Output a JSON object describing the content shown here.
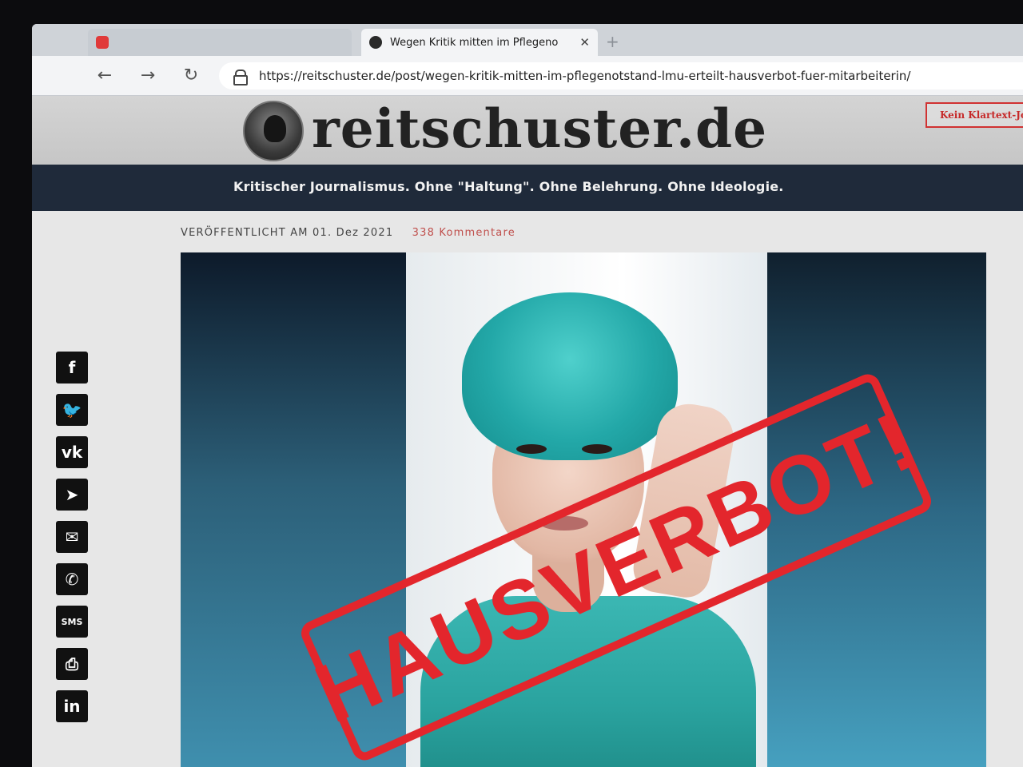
{
  "browser": {
    "tabs": [
      {
        "title": "Wegen Kritik mitten im Pflegeno",
        "active": true
      }
    ],
    "new_tab_label": "+",
    "close_label": "✕",
    "nav": {
      "back": "←",
      "forward": "→",
      "reload": "↻"
    },
    "url": "https://reitschuster.de/post/wegen-kritik-mitten-im-pflegenotstand-lmu-erteilt-hausverbot-fuer-mitarbeiterin/"
  },
  "site": {
    "logo_text": "reitschuster.de",
    "header_button": "Kein Klartext-Jo",
    "tagline": "Kritischer Journalismus. Ohne \"Haltung\". Ohne Belehrung. Ohne Ideologie."
  },
  "article": {
    "published": "VERÖFFENTLICHT AM 01. Dez 2021",
    "comments": "338 Kommentare",
    "stamp_text": "HAUSVERBOT!"
  },
  "share_buttons": [
    {
      "icon": "facebook-icon",
      "glyph": "f"
    },
    {
      "icon": "twitter-icon",
      "glyph": "🐦"
    },
    {
      "icon": "vk-icon",
      "glyph": "vk"
    },
    {
      "icon": "telegram-icon",
      "glyph": "➤"
    },
    {
      "icon": "email-icon",
      "glyph": "✉"
    },
    {
      "icon": "whatsapp-icon",
      "glyph": "✆"
    },
    {
      "icon": "sms-icon",
      "glyph": "SMS"
    },
    {
      "icon": "print-icon",
      "glyph": "⎙"
    },
    {
      "icon": "linkedin-icon",
      "glyph": "in"
    }
  ],
  "colors": {
    "accent_red": "#e3262c",
    "tagline_bar": "#1f2a3a",
    "comments_color": "#c0504d"
  }
}
